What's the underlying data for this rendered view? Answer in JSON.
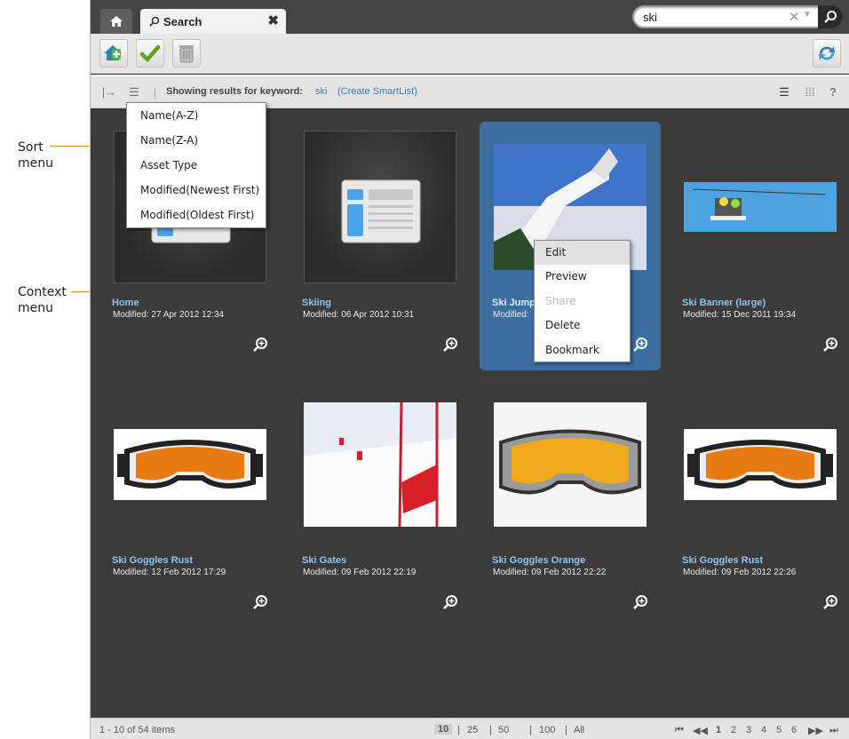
{
  "annotations": {
    "sort": "Sort\nmenu",
    "context": "Context\nmenu"
  },
  "tabs": {
    "search_label": "Search",
    "close": "✖"
  },
  "search": {
    "value": "ski"
  },
  "filter": {
    "showing": "Showing results for keyword:",
    "keyword": "ski",
    "create": "(Create SmartList)"
  },
  "sort_menu": [
    "Name(A-Z)",
    "Name(Z-A)",
    "Asset Type",
    "Modified(Newest First)",
    "Modified(Oldest First)"
  ],
  "context_menu": [
    {
      "label": "Edit",
      "state": "hover"
    },
    {
      "label": "Preview",
      "state": "normal"
    },
    {
      "label": "Share",
      "state": "disabled"
    },
    {
      "label": "Delete",
      "state": "normal"
    },
    {
      "label": "Bookmark",
      "state": "normal"
    }
  ],
  "cards": [
    {
      "title": "Home",
      "modified": "Modified: 27 Apr 2012 12:34",
      "kind": "doc"
    },
    {
      "title": "Skiing",
      "modified": "Modified: 06 Apr 2012 10:31",
      "kind": "doc"
    },
    {
      "title": "Ski Jump",
      "modified": "Modified:",
      "kind": "jump"
    },
    {
      "title": "Ski Banner (large)",
      "modified": "Modified: 15 Dec 2011 19:34",
      "kind": "banner"
    },
    {
      "title": "Ski Goggles Rust",
      "modified": "Modified: 12 Feb 2012 17:29",
      "kind": "goggles"
    },
    {
      "title": "Ski Gates",
      "modified": "Modified: 09 Feb 2012 22:19",
      "kind": "gates"
    },
    {
      "title": "Ski Goggles Orange",
      "modified": "Modified: 09 Feb 2012 22:22",
      "kind": "goggles2"
    },
    {
      "title": "Ski Goggles Rust",
      "modified": "Modified: 09 Feb 2012 22:26",
      "kind": "goggles"
    }
  ],
  "footer": {
    "range": "1 - 10 of 54 items",
    "page_sizes": [
      "10",
      "|",
      "25",
      "|",
      "50",
      "|",
      "100",
      "|",
      "All"
    ],
    "pages": [
      "1",
      "2",
      "3",
      "4",
      "5",
      "6"
    ]
  },
  "colors": {
    "accent": "#3d6ea0",
    "link": "#8fc4f0",
    "arrow": "#f08a24"
  }
}
